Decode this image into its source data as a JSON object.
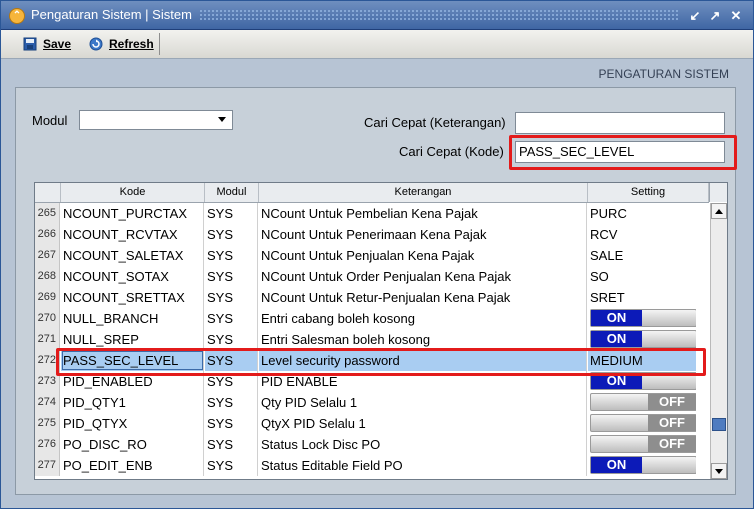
{
  "window": {
    "title": "Pengaturan Sistem | Sistem",
    "buttons": [
      "minimize",
      "maximize",
      "close"
    ]
  },
  "toolbar": {
    "save_label": "Save",
    "refresh_label": "Refresh"
  },
  "section": {
    "title": "PENGATURAN SISTEM"
  },
  "filters": {
    "modul_label": "Modul",
    "modul_value": "",
    "cari_ket_label": "Cari Cepat (Keterangan)",
    "cari_ket_value": "",
    "cari_kode_label": "Cari Cepat (Kode)",
    "cari_kode_value": "PASS_SEC_LEVEL"
  },
  "grid": {
    "columns": [
      "Kode",
      "Modul",
      "Keterangan",
      "Setting"
    ],
    "rows": [
      {
        "no": "265",
        "kode": "NCOUNT_PURCTAX",
        "modul": "SYS",
        "ket": "NCount Untuk Pembelian Kena Pajak",
        "setting": "PURC",
        "type": "text"
      },
      {
        "no": "266",
        "kode": "NCOUNT_RCVTAX",
        "modul": "SYS",
        "ket": "NCount Untuk Penerimaan Kena Pajak",
        "setting": "RCV",
        "type": "text"
      },
      {
        "no": "267",
        "kode": "NCOUNT_SALETAX",
        "modul": "SYS",
        "ket": "NCount Untuk Penjualan Kena Pajak",
        "setting": "SALE",
        "type": "text"
      },
      {
        "no": "268",
        "kode": "NCOUNT_SOTAX",
        "modul": "SYS",
        "ket": "NCount Untuk Order Penjualan Kena Pajak",
        "setting": "SO",
        "type": "text"
      },
      {
        "no": "269",
        "kode": "NCOUNT_SRETTAX",
        "modul": "SYS",
        "ket": "NCount Untuk Retur-Penjualan Kena Pajak",
        "setting": "SRET",
        "type": "text"
      },
      {
        "no": "270",
        "kode": "NULL_BRANCH",
        "modul": "SYS",
        "ket": "Entri cabang boleh kosong",
        "setting": "ON",
        "type": "on"
      },
      {
        "no": "271",
        "kode": "NULL_SREP",
        "modul": "SYS",
        "ket": "Entri Salesman boleh kosong",
        "setting": "ON",
        "type": "on"
      },
      {
        "no": "272",
        "kode": "PASS_SEC_LEVEL",
        "modul": "SYS",
        "ket": "Level security password",
        "setting": "MEDIUM",
        "type": "text",
        "selected": true
      },
      {
        "no": "273",
        "kode": "PID_ENABLED",
        "modul": "SYS",
        "ket": "PID ENABLE",
        "setting": "ON",
        "type": "on"
      },
      {
        "no": "274",
        "kode": "PID_QTY1",
        "modul": "SYS",
        "ket": "Qty PID Selalu 1",
        "setting": "OFF",
        "type": "off"
      },
      {
        "no": "275",
        "kode": "PID_QTYX",
        "modul": "SYS",
        "ket": "QtyX PID Selalu 1",
        "setting": "OFF",
        "type": "off"
      },
      {
        "no": "276",
        "kode": "PO_DISC_RO",
        "modul": "SYS",
        "ket": "Status Lock Disc PO",
        "setting": "OFF",
        "type": "off"
      },
      {
        "no": "277",
        "kode": "PO_EDIT_ENB",
        "modul": "SYS",
        "ket": "Status Editable Field PO",
        "setting": "ON",
        "type": "on"
      }
    ]
  },
  "colors": {
    "highlight": "#e31b1b",
    "selected_row": "#a9cdf2",
    "toggle_on": "#0c1ab8",
    "toggle_off": "#8e8e8e",
    "titlebar": "#3f66a4"
  }
}
